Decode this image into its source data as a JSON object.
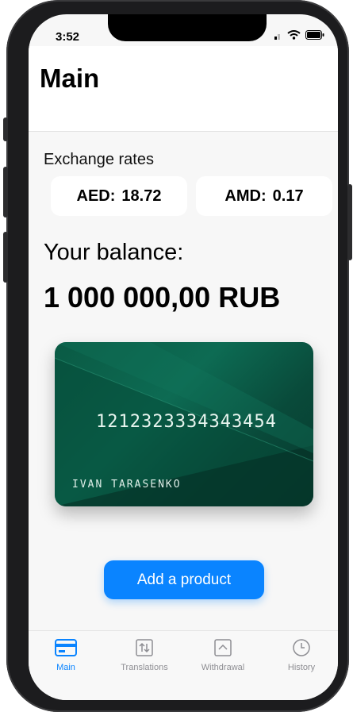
{
  "status_bar": {
    "time": "3:52"
  },
  "header": {
    "title": "Main"
  },
  "exchange": {
    "title": "Exchange rates",
    "rates": [
      {
        "code": "AED:",
        "value": "18.72"
      },
      {
        "code": "AMD:",
        "value": "0.17"
      }
    ]
  },
  "balance": {
    "label": "Your balance:",
    "value": "1 000 000,00 RUB"
  },
  "card": {
    "number": "1212323334343454",
    "holder": "IVAN TARASENKO"
  },
  "actions": {
    "add_product": "Add a product"
  },
  "tabs": [
    {
      "label": "Main",
      "icon": "card-icon",
      "active": true
    },
    {
      "label": "Translations",
      "icon": "transfer-arrows-icon",
      "active": false
    },
    {
      "label": "Withdrawal",
      "icon": "withdraw-up-icon",
      "active": false
    },
    {
      "label": "History",
      "icon": "clock-icon",
      "active": false
    }
  ],
  "colors": {
    "accent": "#0a84ff",
    "card_green": "#0b5e48",
    "background": "#f7f7f7"
  }
}
